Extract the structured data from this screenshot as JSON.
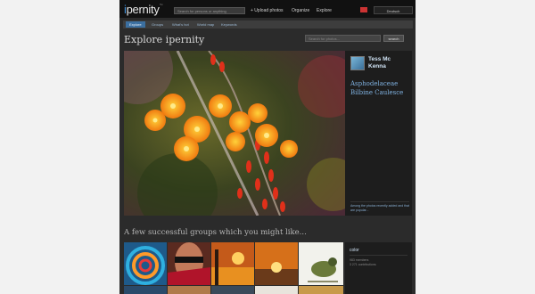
{
  "header": {
    "logo": "ipernity",
    "search_placeholder": "Search for persons or anything",
    "upload_label": "+ Upload photos",
    "organize_label": "Organize",
    "explore_label": "Explore",
    "language": "Deutsch"
  },
  "nav": {
    "tabs": [
      {
        "label": "Explore"
      },
      {
        "label": "Groups"
      },
      {
        "label": "What's hot"
      },
      {
        "label": "World map"
      },
      {
        "label": "Keywords"
      }
    ]
  },
  "main": {
    "title": "Explore ipernity",
    "photo_search_placeholder": "Search for photos...",
    "search_button": "search"
  },
  "featured": {
    "author": "Tess Mc Kenna",
    "photo_title": "Asphodelaceae Bilbine Caulesce",
    "caption": "Among the photos recently added and that are popular..."
  },
  "groups": {
    "heading": "A few successful groups which you might like...",
    "group_name": "color",
    "members": "983 members",
    "contributions": "3 271 contributions"
  },
  "colors": {
    "accent": "#3b6fa0",
    "link": "#7fb1e0",
    "background": "#2b2b2b"
  }
}
